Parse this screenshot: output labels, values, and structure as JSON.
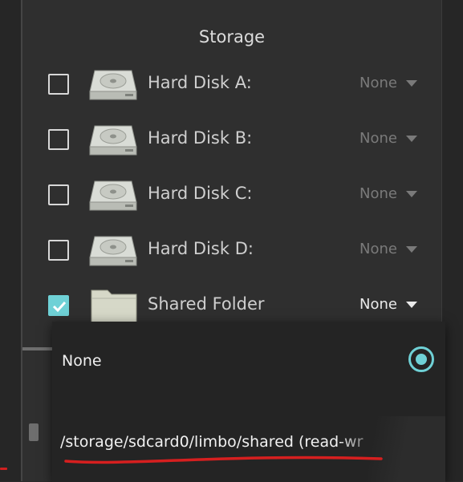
{
  "dialog": {
    "title": "Storage"
  },
  "rows": [
    {
      "label": "Hard Disk A:",
      "value": "None",
      "checked": false,
      "icon": "hard-disk-icon"
    },
    {
      "label": "Hard Disk B:",
      "value": "None",
      "checked": false,
      "icon": "hard-disk-icon"
    },
    {
      "label": "Hard Disk C:",
      "value": "None",
      "checked": false,
      "icon": "hard-disk-icon"
    },
    {
      "label": "Hard Disk D:",
      "value": "None",
      "checked": false,
      "icon": "hard-disk-icon"
    },
    {
      "label": "Shared Folder",
      "value": "None",
      "checked": true,
      "icon": "folder-icon"
    }
  ],
  "dropdown": {
    "options": [
      {
        "label": "None",
        "selected": true
      },
      {
        "label": "/storage/sdcard0/limbo/shared (read-wr",
        "selected": false
      }
    ]
  },
  "colors": {
    "accent": "#6fd1d6",
    "annotation": "#d61f1f",
    "background": "#2f2f2f"
  }
}
